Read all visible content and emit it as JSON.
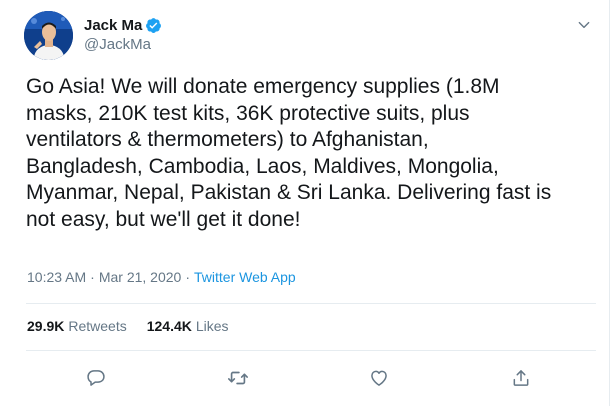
{
  "author": {
    "display_name": "Jack Ma",
    "handle": "@JackMa",
    "verified": true
  },
  "tweet": {
    "text": "Go Asia! We will donate emergency supplies (1.8M\nmasks, 210K test kits, 36K protective suits, plus\nventilators & thermometers) to Afghanistan,\nBangladesh, Cambodia, Laos, Maldives, Mongolia,\nMyanmar, Nepal, Pakistan & Sri Lanka. Delivering fast is\nnot easy, but we'll get it done!",
    "time": "10:23 AM",
    "separator": "·",
    "date": "Mar 21, 2020",
    "source": "Twitter Web App"
  },
  "stats": {
    "retweets_count": "29.9K",
    "retweets_label": "Retweets",
    "likes_count": "124.4K",
    "likes_label": "Likes"
  },
  "icons": {
    "verified": "verified-badge-icon",
    "menu": "chevron-down-icon",
    "reply": "reply-icon",
    "retweet": "retweet-icon",
    "like": "heart-icon",
    "share": "share-icon"
  },
  "colors": {
    "accent": "#1b95e0",
    "verified": "#1da1f2",
    "text": "#14171a",
    "muted": "#657786",
    "divider": "#e6ecf0"
  }
}
